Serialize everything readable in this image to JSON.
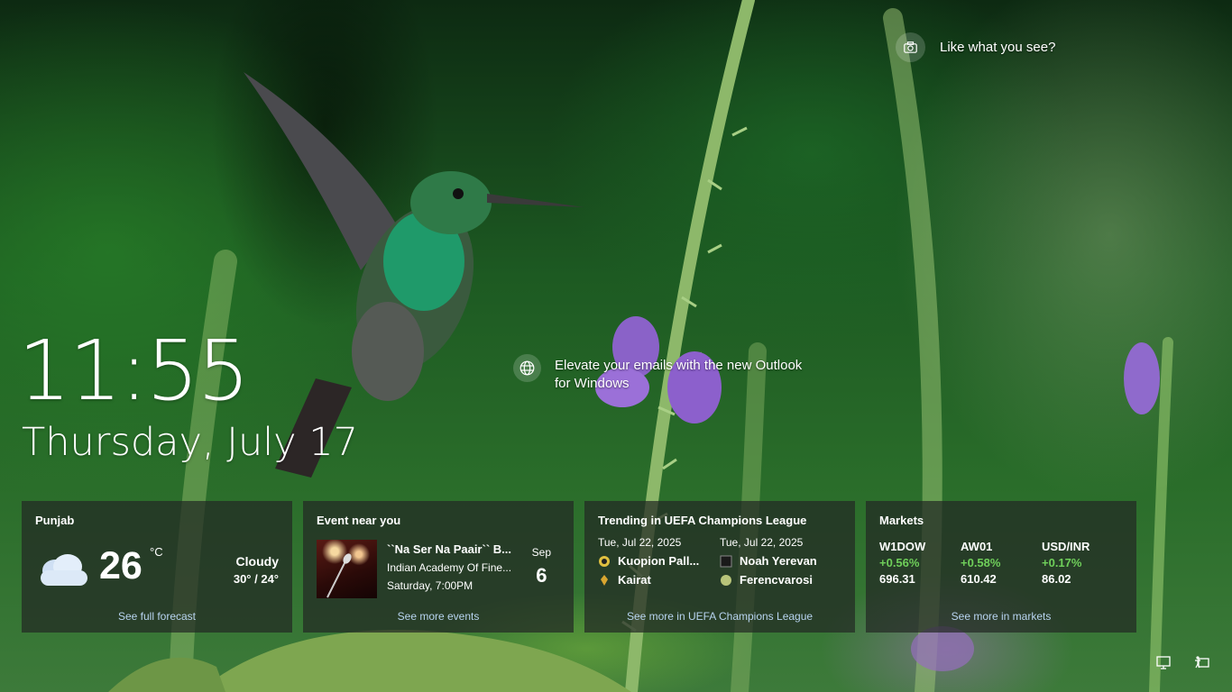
{
  "spotlight": {
    "label": "Like what you see?",
    "icon": "camera-icon"
  },
  "clock": {
    "time": "11:55",
    "date": "Thursday, July 17"
  },
  "promo": {
    "text": "Elevate your emails with the new Outlook for Windows",
    "icon": "globe-icon"
  },
  "weather": {
    "title": "Punjab",
    "temp": "26",
    "unit": "°C",
    "condition": "Cloudy",
    "range": "30° / 24°",
    "link": "See full forecast",
    "icon": "cloud-icon"
  },
  "event": {
    "title": "Event near you",
    "name": "``Na Ser Na Paair`` B...",
    "venue": "Indian Academy Of Fine...",
    "time": "Saturday, 7:00PM",
    "month": "Sep",
    "day": "6",
    "link": "See more events"
  },
  "trending": {
    "title": "Trending in UEFA Champions League",
    "matches": [
      {
        "date": "Tue, Jul 22, 2025",
        "team1": "Kuopion Pall...",
        "team2": "Kairat"
      },
      {
        "date": "Tue, Jul 22, 2025",
        "team1": "Noah Yerevan",
        "team2": "Ferencvarosi"
      }
    ],
    "link": "See more in UEFA Champions League"
  },
  "markets": {
    "title": "Markets",
    "items": [
      {
        "symbol": "W1DOW",
        "change": "+0.56%",
        "value": "696.31"
      },
      {
        "symbol": "AW01",
        "change": "+0.58%",
        "value": "610.42"
      },
      {
        "symbol": "USD/INR",
        "change": "+0.17%",
        "value": "86.02"
      }
    ],
    "link": "See more in markets",
    "positive_color": "#6fcf5a"
  },
  "tray": {
    "network_icon": "network-icon",
    "accessibility_icon": "ease-of-access-icon"
  }
}
